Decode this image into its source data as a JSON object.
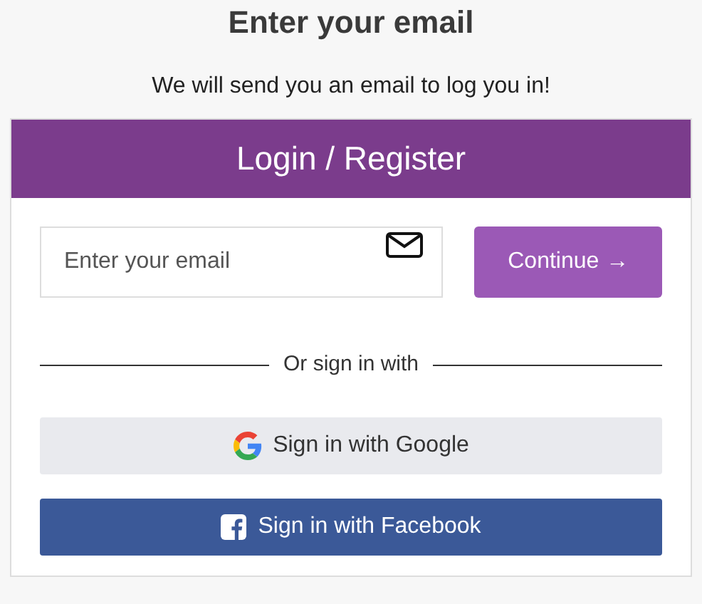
{
  "heading": "Enter your email",
  "subtitle": "We will send you an email to log you in!",
  "card": {
    "title": "Login / Register",
    "email_field": {
      "placeholder": "Enter your email"
    },
    "continue_button": {
      "label": "Continue",
      "arrow": "→"
    },
    "divider_text": "Or sign in with",
    "social_buttons": [
      {
        "kind": "google",
        "label": "Sign in with Google"
      },
      {
        "kind": "facebook",
        "label": "Sign in with Facebook"
      }
    ]
  }
}
